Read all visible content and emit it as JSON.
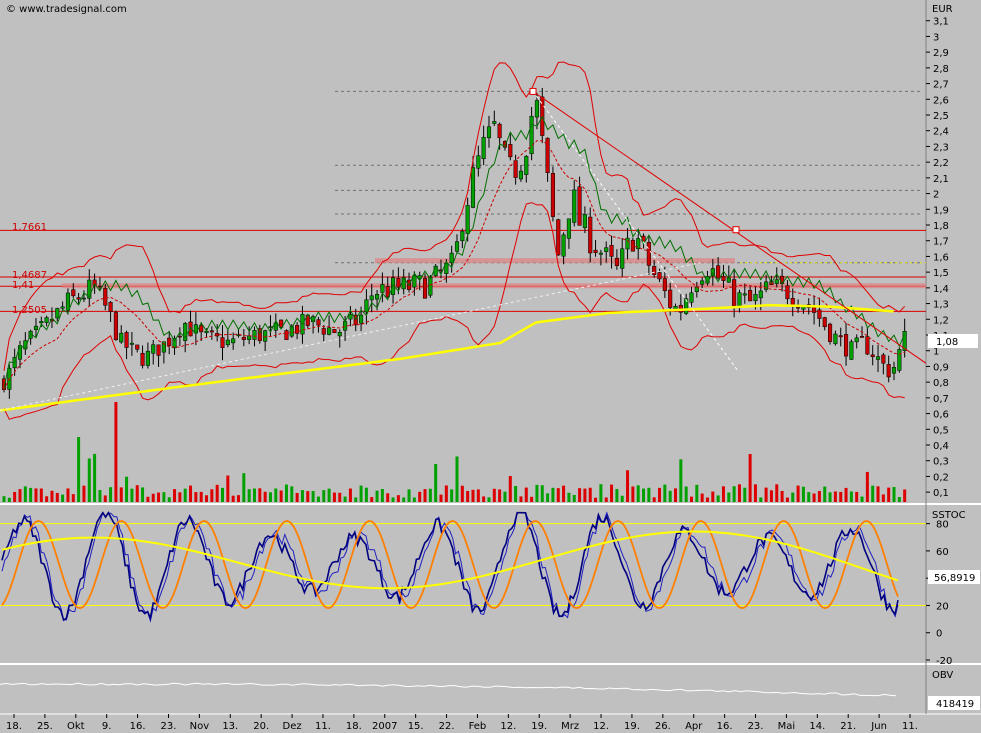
{
  "source": "© www.tradesignal.com",
  "currency": "EUR",
  "price_panel": {
    "y_ticks": [
      "3,1",
      "3",
      "2,9",
      "2,8",
      "2,7",
      "2,6",
      "2,5",
      "2,4",
      "2,3",
      "2,2",
      "2,1",
      "2",
      "1,9",
      "1,8",
      "1,7",
      "1,6",
      "1,5",
      "1,4",
      "1,3",
      "1,2",
      "1,1",
      "1",
      "0,9",
      "0,8",
      "0,7",
      "0,6",
      "0,5",
      "0,4",
      "0,3",
      "0,2",
      "0,1"
    ],
    "last_price_label": "1,08",
    "level_labels": [
      "1,7661",
      "1,4687",
      "1,41",
      "1,2505"
    ]
  },
  "stoch_panel": {
    "title": "SSTOC",
    "y_ticks": [
      "80",
      "60",
      "40",
      "20",
      "0",
      "-20"
    ],
    "value_label": "56,8919"
  },
  "obv_panel": {
    "title": "OBV",
    "value_label": "418419"
  },
  "x_labels": [
    "18.",
    "25.",
    "Okt",
    "9.",
    "16.",
    "23.",
    "Nov",
    "13.",
    "20.",
    "Dez",
    "11.",
    "18.",
    "2007",
    "15.",
    "22.",
    "Feb",
    "12.",
    "19.",
    "Mrz",
    "12.",
    "19.",
    "26.",
    "Apr",
    "16.",
    "23.",
    "Mai",
    "14.",
    "21.",
    "Jun",
    "11."
  ],
  "chart_data": {
    "type": "candlestick",
    "unit": "EUR",
    "ylim": [
      0.05,
      3.2
    ],
    "price_path": [
      [
        0.0,
        0.8
      ],
      [
        0.02,
        1.02
      ],
      [
        0.045,
        1.15
      ],
      [
        0.07,
        1.3
      ],
      [
        0.1,
        1.4
      ],
      [
        0.115,
        1.25
      ],
      [
        0.13,
        1.05
      ],
      [
        0.155,
        0.95
      ],
      [
        0.18,
        1.05
      ],
      [
        0.2,
        1.18
      ],
      [
        0.22,
        1.08
      ],
      [
        0.25,
        1.05
      ],
      [
        0.28,
        1.1
      ],
      [
        0.31,
        1.12
      ],
      [
        0.34,
        1.18
      ],
      [
        0.37,
        1.12
      ],
      [
        0.395,
        1.2
      ],
      [
        0.41,
        1.38
      ],
      [
        0.44,
        1.4
      ],
      [
        0.47,
        1.42
      ],
      [
        0.5,
        1.55
      ],
      [
        0.51,
        1.9
      ],
      [
        0.53,
        2.25
      ],
      [
        0.545,
        2.4
      ],
      [
        0.56,
        2.1
      ],
      [
        0.575,
        2.25
      ],
      [
        0.59,
        2.6
      ],
      [
        0.605,
        2.0
      ],
      [
        0.615,
        1.6
      ],
      [
        0.63,
        2.0
      ],
      [
        0.64,
        1.8
      ],
      [
        0.66,
        1.65
      ],
      [
        0.68,
        1.5
      ],
      [
        0.7,
        1.75
      ],
      [
        0.72,
        1.5
      ],
      [
        0.74,
        1.3
      ],
      [
        0.75,
        1.25
      ],
      [
        0.765,
        1.45
      ],
      [
        0.78,
        1.55
      ],
      [
        0.795,
        1.45
      ],
      [
        0.81,
        1.35
      ],
      [
        0.83,
        1.3
      ],
      [
        0.85,
        1.4
      ],
      [
        0.87,
        1.38
      ],
      [
        0.885,
        1.33
      ],
      [
        0.9,
        1.25
      ],
      [
        0.92,
        1.1
      ],
      [
        0.94,
        1.0
      ],
      [
        0.955,
        1.05
      ],
      [
        0.97,
        0.95
      ],
      [
        0.985,
        0.85
      ],
      [
        1.0,
        1.08
      ]
    ],
    "horizontal_levels": [
      1.7661,
      1.4687,
      1.41,
      1.2505
    ],
    "fib_levels": [
      2.65,
      2.18,
      2.02,
      1.87,
      1.56
    ],
    "sma200_path": [
      [
        0.0,
        0.62
      ],
      [
        0.2,
        0.77
      ],
      [
        0.45,
        0.95
      ],
      [
        0.56,
        1.05
      ],
      [
        0.6,
        1.18
      ],
      [
        0.68,
        1.24
      ],
      [
        0.8,
        1.27
      ],
      [
        0.86,
        1.29
      ],
      [
        0.93,
        1.28
      ],
      [
        1.0,
        1.25
      ]
    ],
    "stoch_levels": [
      80,
      20
    ],
    "last_price": 1.08,
    "stoch_last": 56.8919,
    "obv_last": 418419
  }
}
